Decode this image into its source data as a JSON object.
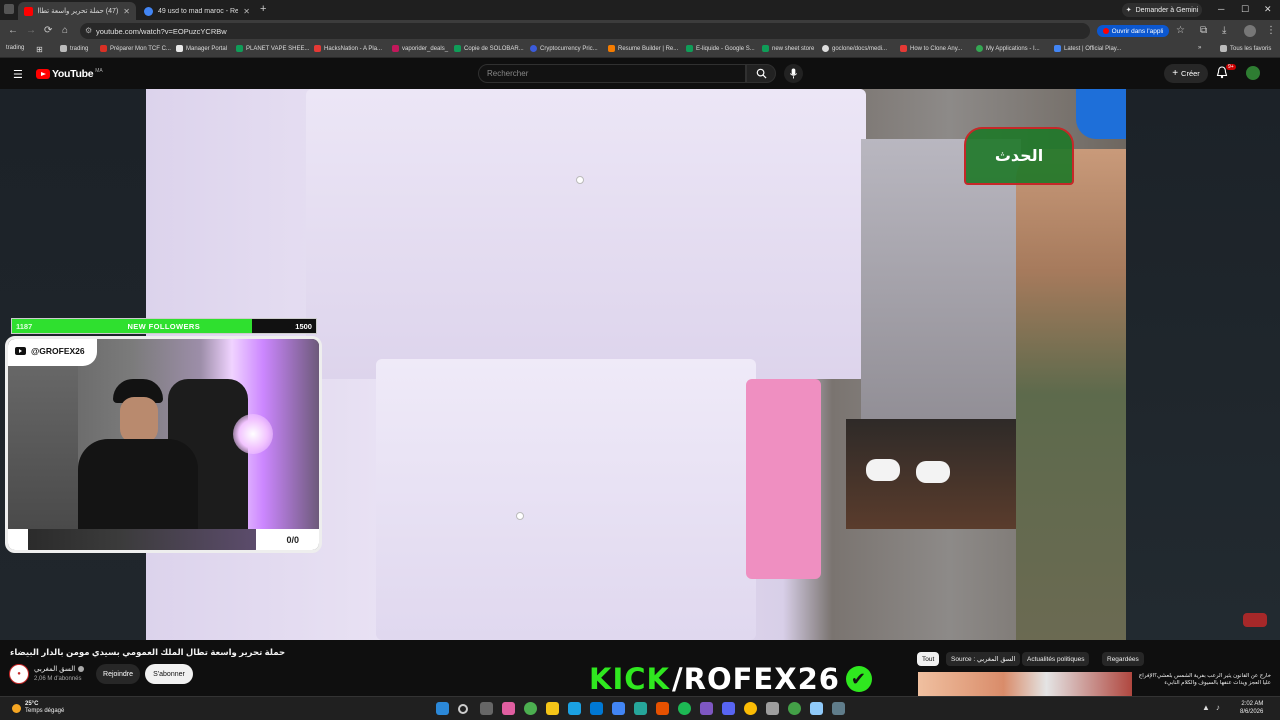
{
  "browser": {
    "tabs": [
      {
        "label": "(47) حملة تحرير واسعة تطال",
        "active": true,
        "favicon_color": "#ff0000"
      },
      {
        "label": "49 usd to mad maroc - Recherc",
        "active": false,
        "favicon_color": "#4285f4"
      }
    ],
    "new_tab": "+",
    "gemini_label": "Demander à Gemini",
    "url": "youtube.com/watch?v=EOPuzcYCRBw",
    "open_app_label": "Ouvrir dans l'appli",
    "bookmarks": [
      {
        "label": "trading"
      },
      {
        "label": "trading"
      },
      {
        "label": "Préparer Mon TCF C..."
      },
      {
        "label": "Manager Portal"
      },
      {
        "label": "PLANET VAPE SHEE..."
      },
      {
        "label": "HacksNation - A Pla..."
      },
      {
        "label": "vaporider_deals_"
      },
      {
        "label": "Copie de SOLOBAR..."
      },
      {
        "label": "Cryptocurrency Pric..."
      },
      {
        "label": "Resume Builder | Re..."
      },
      {
        "label": "E-liquide - Google S..."
      },
      {
        "label": "new sheet store"
      },
      {
        "label": "goclone/docs/medi..."
      },
      {
        "label": "How to Clone Any..."
      },
      {
        "label": "My Applications - I..."
      },
      {
        "label": "Latest | Official Play..."
      },
      {
        "label": "Tous les favoris"
      }
    ]
  },
  "youtube": {
    "logo_text": "YouTube",
    "country_code": "MA",
    "search_placeholder": "Rechercher",
    "create_label": "Créer",
    "notif_count": "9+"
  },
  "overlay": {
    "followers_current": "1187",
    "followers_label": "NEW FOLLOWERS",
    "followers_goal": "1500",
    "followers_progress": 0.79,
    "handle": "@GROFEX26",
    "score": "0/0"
  },
  "video": {
    "title": "حملة تحرير واسعة تطال الملك العمومي بسيدي مومن بالدار البيضاء",
    "channel_name": "السق المغربي",
    "subscribers": "2,06 M d'abonnés",
    "join_label": "Rejoindre",
    "subscribe_label": "S'abonner",
    "chanlogo_text": "الحدث"
  },
  "kick_banner": {
    "part1": "KICK",
    "part2": "/ROFEX26",
    "check": "✔"
  },
  "chips": [
    {
      "label": "Tout",
      "selected": true
    },
    {
      "label": "Source : السق المغربي",
      "selected": false
    },
    {
      "label": "Actualités politiques",
      "selected": false
    },
    {
      "label": "Regardées",
      "selected": false
    }
  ],
  "recommended": {
    "text": "خارج عن القانون يثير الرعب بفرية الشمس بلعشي؟الإفراج عليا العجز ويدات عنفها بالسيوف والكلام النابيء"
  },
  "taskbar": {
    "temp": "25°C",
    "weather": "Temps dégagé",
    "time": "2:02 AM",
    "date": "8/6/2026"
  }
}
